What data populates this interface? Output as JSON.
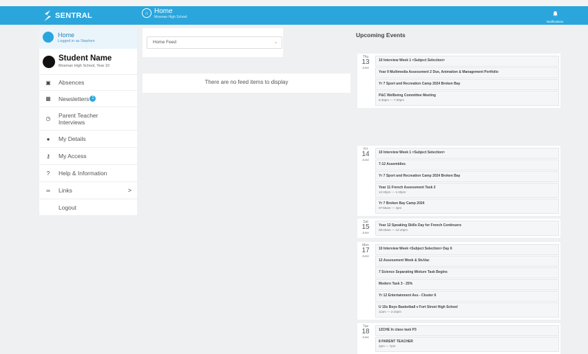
{
  "header": {
    "brand": "SENTRAL",
    "title": "Home",
    "subtitle": "Mosman High School",
    "notifications_label": "Notifications"
  },
  "sidebar": {
    "home_title": "Home",
    "home_sub": "Logged in as Stephen",
    "student_name": "Student Name",
    "student_school": "Mosman High School, Year 10",
    "items": [
      {
        "label": "Absences",
        "icon": "calendar-icon"
      },
      {
        "label": "Newsletters",
        "icon": "newspaper-icon",
        "badge": "1"
      },
      {
        "label": "Parent Teacher Interviews",
        "icon": "clock-icon"
      },
      {
        "label": "My Details",
        "icon": "user-icon"
      },
      {
        "label": "My Access",
        "icon": "key-icon"
      },
      {
        "label": "Help & Information",
        "icon": "question-icon"
      },
      {
        "label": "Links",
        "icon": "link-icon",
        "chevron": ">"
      },
      {
        "label": "Logout",
        "icon": ""
      }
    ]
  },
  "feed": {
    "select_value": "Home Feed",
    "empty_text": "There are no feed items to display"
  },
  "events": {
    "title": "Upcoming Events",
    "days": [
      {
        "weekday": "Thu",
        "day": "13",
        "month": "June",
        "items": [
          {
            "name": "10 Interview Week 1 <Subject Selection>",
            "time": ""
          },
          {
            "name": "Year 9 Multimedia Assessment 2 Due, Animation & Management Portfolio",
            "time": ""
          },
          {
            "name": "Yr 7 Sport and Recreation Camp 2024 Broken Bay",
            "time": ""
          },
          {
            "name": "P&C Wellbeing Committee Meeting",
            "time": "6:30pm — 7:30pm"
          }
        ]
      },
      {
        "weekday": "Fri",
        "day": "14",
        "month": "June",
        "items": [
          {
            "name": "10 Interview Week 1 <Subject Selection>",
            "time": ""
          },
          {
            "name": "7-12 Assemblies",
            "time": ""
          },
          {
            "name": "Yr 7 Sport and Recreation Camp 2024 Broken Bay",
            "time": ""
          },
          {
            "name": "Year 11 French Assessment Task 2",
            "time": "12:40pm — 1:40pm"
          },
          {
            "name": "Yr 7 Broken Bay Camp 2024",
            "time": "07:55am — 4pm"
          }
        ]
      },
      {
        "weekday": "Sat",
        "day": "15",
        "month": "June",
        "items": [
          {
            "name": "Year 12 Speaking Skills Day for French Continuers",
            "time": "08:40am — 12:10pm"
          }
        ]
      },
      {
        "weekday": "Mon",
        "day": "17",
        "month": "June",
        "items": [
          {
            "name": "10 Interview Week <Subject Selection> Day 6",
            "time": ""
          },
          {
            "name": "12 Assessment Week & StuVac",
            "time": ""
          },
          {
            "name": "7 Science Separating Mixture Task Begins",
            "time": ""
          },
          {
            "name": "Modern Task 3 - 25%",
            "time": ""
          },
          {
            "name": "Yr 12 Entertainment Ass - Cluster 6",
            "time": ""
          },
          {
            "name": "U 15s Boys Basketball v Fort Street High School",
            "time": "11am — 2:15pm"
          }
        ]
      },
      {
        "weekday": "Tue",
        "day": "18",
        "month": "June",
        "items": [
          {
            "name": "12CHE In class task P3",
            "time": ""
          },
          {
            "name": "8 PARENT TEACHER",
            "time": "4pm — 7pm"
          }
        ]
      }
    ]
  },
  "colors": {
    "accent": "#2aa6dc"
  }
}
